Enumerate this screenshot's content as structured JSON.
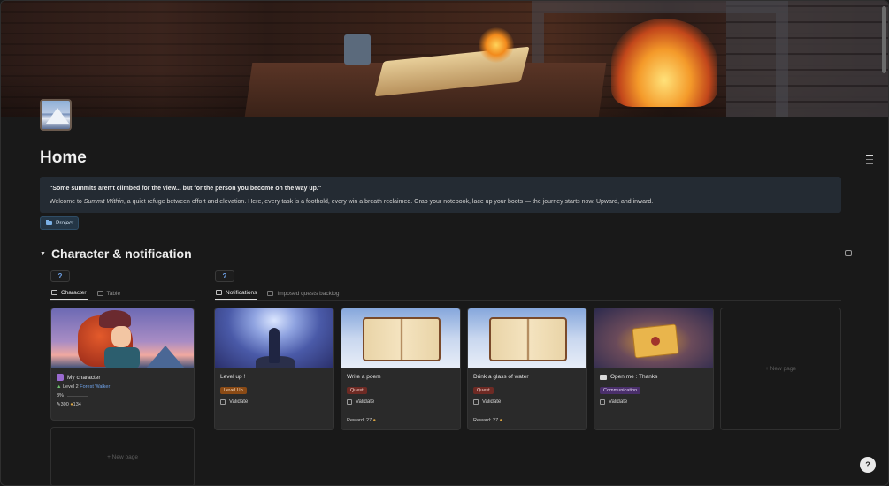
{
  "page": {
    "title": "Home",
    "quote": "\"Some summits aren't climbed for the view... but for the person you become on the way up.\"",
    "welcome_prefix": "Welcome to ",
    "welcome_name": "Summit Within",
    "welcome_suffix": ", a quiet refuge between effort and elevation. Here, every task is a foothold, every win a breath reclaimed. Grab your notebook, lace up your boots — the journey starts now. Upward, and inward.",
    "project_label": "Project"
  },
  "section": {
    "title": "Character & notification"
  },
  "character_view": {
    "help_label": "?",
    "tabs": [
      {
        "label": "Character",
        "active": true
      },
      {
        "label": "Table",
        "active": false
      }
    ],
    "card": {
      "name": "My character",
      "level": "Level 2",
      "class": "Forest Walker",
      "progress": "3%",
      "stats": "300",
      "gold": "134"
    },
    "new_page": "+ New page"
  },
  "notifications_view": {
    "help_label": "?",
    "tabs": [
      {
        "label": "Notifications",
        "active": true
      },
      {
        "label": "Imposed quests backlog",
        "active": false
      }
    ],
    "cards": [
      {
        "title": "Level up !",
        "tag": "Level Up",
        "validate": "Validate",
        "reward": ""
      },
      {
        "title": "Write a poem",
        "tag": "Quest",
        "validate": "Validate",
        "reward": "Reward: 27"
      },
      {
        "title": "Drink a glass of water",
        "tag": "Quest",
        "validate": "Validate",
        "reward": "Reward: 27"
      },
      {
        "title": "Open me : Thanks",
        "tag": "Communication",
        "validate": "Validate",
        "reward": ""
      }
    ],
    "new_page": "+ New page"
  },
  "help_button": "?",
  "colors": {
    "background": "#191919",
    "accent_blue": "#6fa3ea",
    "tag_levelup": "#8a4a15",
    "tag_quest": "#6e2a24",
    "tag_communication": "#4a2f6b"
  }
}
